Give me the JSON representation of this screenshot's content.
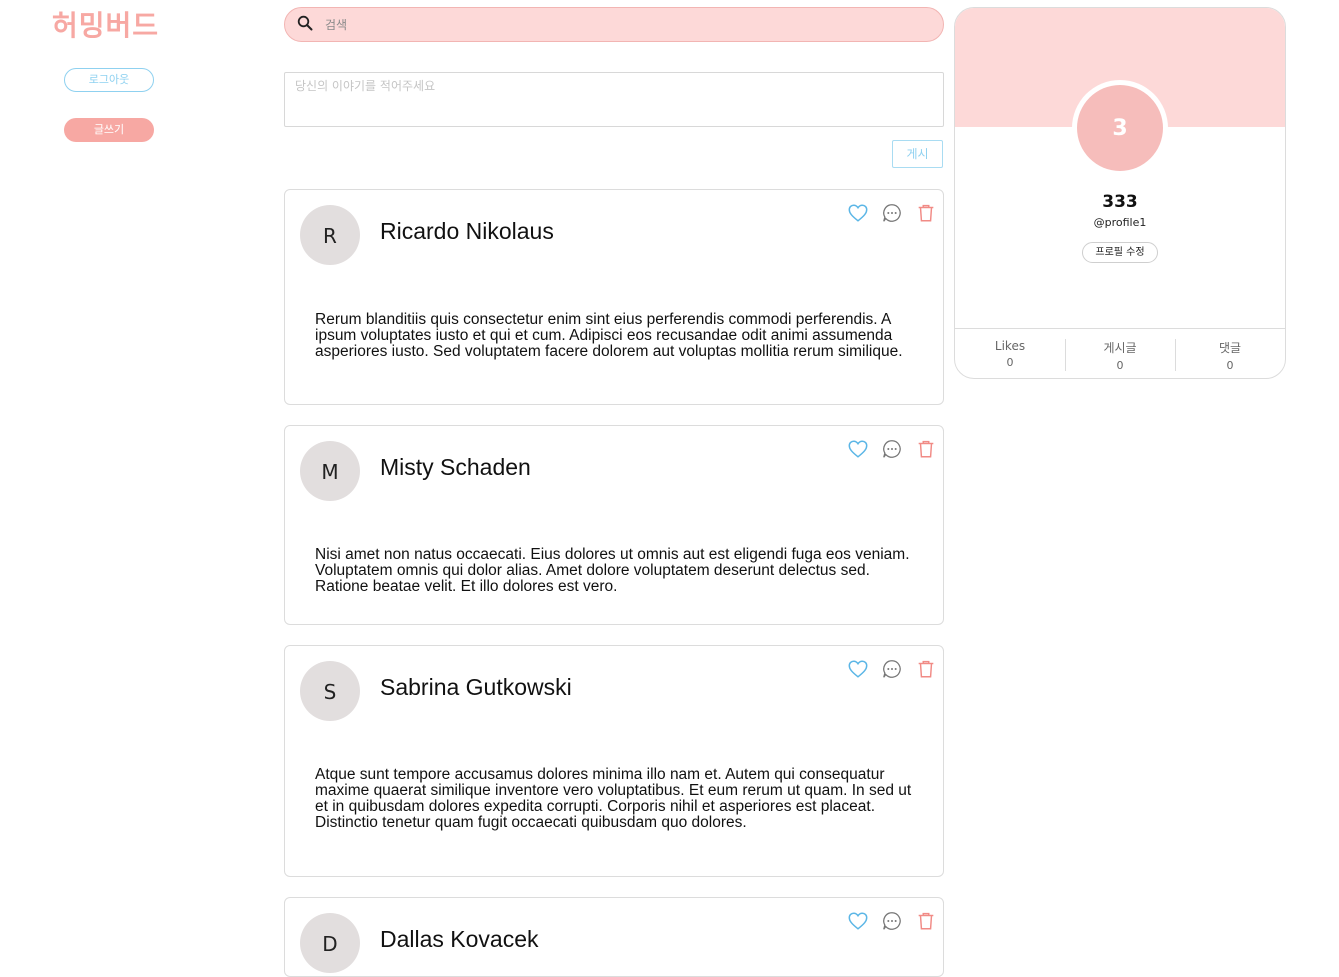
{
  "app": {
    "logo": "허밍버드"
  },
  "sidebar": {
    "logout_label": "로그아웃",
    "write_label": "글쓰기"
  },
  "search": {
    "placeholder": "검색",
    "icon": "search-icon"
  },
  "composer": {
    "placeholder": "당신의 이야기를 적어주세요",
    "post_label": "게시"
  },
  "posts": [
    {
      "initial": "R",
      "author": "Ricardo Nikolaus",
      "body": "Rerum blanditiis quis consectetur enim sint eius perferendis commodi perferendis. A ipsum voluptates iusto et qui et cum. Adipisci eos recusandae odit animi assumenda asperiores iusto. Sed voluptatem facere dolorem aut voluptas mollitia rerum similique."
    },
    {
      "initial": "M",
      "author": "Misty Schaden",
      "body": "Nisi amet non natus occaecati. Eius dolores ut omnis aut est eligendi fuga eos veniam. Voluptatem omnis qui dolor alias. Amet dolore voluptatem deserunt delectus sed. Ratione beatae velit. Et illo dolores est vero."
    },
    {
      "initial": "S",
      "author": "Sabrina Gutkowski",
      "body": "Atque sunt tempore accusamus dolores minima illo nam et. Autem qui consequatur maxime quaerat similique inventore vero voluptatibus. Et eum rerum ut quam. In sed ut et in quibusdam dolores expedita corrupti. Corporis nihil et asperiores est placeat. Distinctio tenetur quam fugit occaecati quibusdam quo dolores."
    },
    {
      "initial": "D",
      "author": "Dallas Kovacek",
      "body": ""
    }
  ],
  "post_actions": {
    "like_icon": "heart-icon",
    "comment_icon": "comment-icon",
    "delete_icon": "trash-icon"
  },
  "profile": {
    "avatar_text": "3",
    "name": "333",
    "handle": "@profile1",
    "edit_label": "프로필 수정",
    "stats": [
      {
        "label": "Likes",
        "value": "0"
      },
      {
        "label": "게시글",
        "value": "0"
      },
      {
        "label": "댓글",
        "value": "0"
      }
    ]
  },
  "colors": {
    "brand_pink": "#f7a8a3",
    "light_pink": "#fdd9d8",
    "accent_blue": "#8fd1f0",
    "avatar_gray": "#e2dede"
  }
}
